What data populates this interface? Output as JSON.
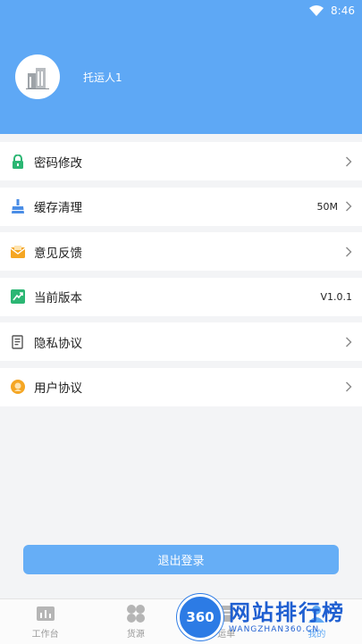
{
  "status_bar": {
    "time": "8:46"
  },
  "profile": {
    "name": "托运人1"
  },
  "menu": [
    {
      "label": "密码修改",
      "value": "",
      "icon": "lock-icon",
      "color": "#2bb673"
    },
    {
      "label": "缓存清理",
      "value": "50M",
      "icon": "broom-icon",
      "color": "#4a8de6"
    },
    {
      "label": "意见反馈",
      "value": "",
      "icon": "envelope-icon",
      "color": "#f5a623"
    },
    {
      "label": "当前版本",
      "value": "V1.0.1",
      "icon": "trend-icon",
      "color": "#2bb673"
    },
    {
      "label": "隐私协议",
      "value": "",
      "icon": "document-icon",
      "color": "#555555"
    },
    {
      "label": "用户协议",
      "value": "",
      "icon": "smile-icon",
      "color": "#f5a623"
    }
  ],
  "logout": {
    "label": "退出登录"
  },
  "bottom_nav": [
    {
      "label": "工作台",
      "icon": "bar-chart-icon"
    },
    {
      "label": "货源",
      "icon": "grid-icon"
    },
    {
      "label": "运单",
      "icon": "list-icon"
    },
    {
      "label": "我的",
      "icon": "person-icon"
    }
  ],
  "watermark": {
    "logo": "360",
    "title": "网站排行榜",
    "sub": "WANGZHAN360.CN"
  }
}
